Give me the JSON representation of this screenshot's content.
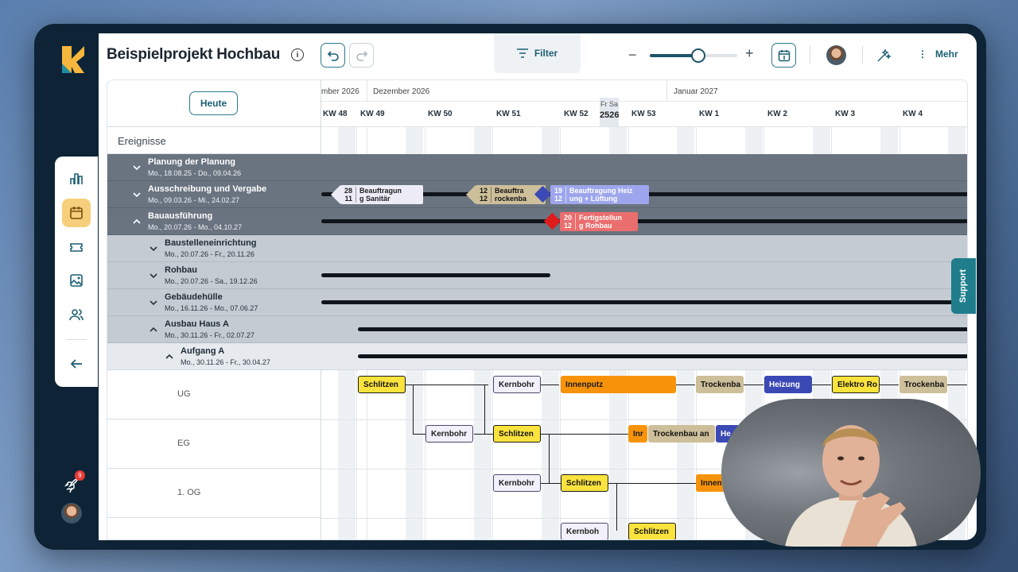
{
  "project": {
    "title": "Beispielprojekt Hochbau"
  },
  "toolbar": {
    "filter_label": "Filter",
    "more_label": "Mehr",
    "zoom_percent": 55
  },
  "sidebar": {
    "notification_count": "9"
  },
  "gantt": {
    "today_button": "Heute",
    "events_label": "Ereignisse",
    "months": [
      "mber 2026",
      "Dezember 2026",
      "Januar 2027"
    ],
    "weeks": [
      "KW 48",
      "KW 49",
      "KW 50",
      "KW 51",
      "KW 52",
      "KW 53",
      "KW 1",
      "KW 2",
      "KW 3",
      "KW 4"
    ],
    "today": {
      "days": "Fr Sa",
      "dates": "2526"
    },
    "rows": [
      {
        "name": "Planung der Planung",
        "dates": "Mo., 18.08.25 - Do., 09.04.26",
        "chevron": "down"
      },
      {
        "name": "Ausschreibung und Vergabe",
        "dates": "Mo., 09.03.26 - Mi., 24.02.27",
        "chevron": "down"
      },
      {
        "name": "Bauausführung",
        "dates": "Mo., 20.07.26 - Mo., 04.10.27",
        "chevron": "up"
      },
      {
        "name": "Baustelleneinrichtung",
        "dates": "Mo., 20.07.26 - Fr., 20.11.26",
        "chevron": "down"
      },
      {
        "name": "Rohbau",
        "dates": "Mo., 20.07.26 - Sa., 19.12.26",
        "chevron": "down"
      },
      {
        "name": "Gebäudehülle",
        "dates": "Mo., 16.11.26 - Mo., 07.06.27",
        "chevron": "down"
      },
      {
        "name": "Ausbau Haus A",
        "dates": "Mo., 30.11.26 - Fr., 02.07.27",
        "chevron": "up"
      },
      {
        "name": "Aufgang A",
        "dates": "Mo., 30.11.26 - Fr., 30.04.27",
        "chevron": "up"
      }
    ],
    "floors": [
      "UG",
      "EG",
      "1. OG"
    ],
    "milestones": [
      {
        "num": "28\n11",
        "text": "Beauftragun\ng Sanitär"
      },
      {
        "num": "12\n12",
        "text": "Beauftra\nrockenba"
      },
      {
        "num": "19\n12",
        "text": "Beauftragung Heiz\nung + Lüftung"
      },
      {
        "num": "20\n12",
        "text": "Fertigstellun\ng Rohbau"
      }
    ],
    "tasks": {
      "ug": [
        "Schlitzen",
        "Kernbohr",
        "Innenputz",
        "Trockenba",
        "Heizung",
        "Elektro Ro",
        "Trockenba"
      ],
      "eg": [
        "Kernbohr",
        "Schlitzen",
        "Inr",
        "Trockenbau an",
        "He"
      ],
      "og1": [
        "Kernbohr",
        "Schlitzen",
        "Innen"
      ],
      "og2": [
        "Kernboh",
        "Schlitzen"
      ]
    }
  },
  "support_label": "Support",
  "colors": {
    "accent": "#1f5368",
    "sidebar_bg": "#0e2436",
    "dark_row": "#6a7480",
    "mid_row": "#c4cbd2",
    "light_row": "#e6eaef"
  }
}
